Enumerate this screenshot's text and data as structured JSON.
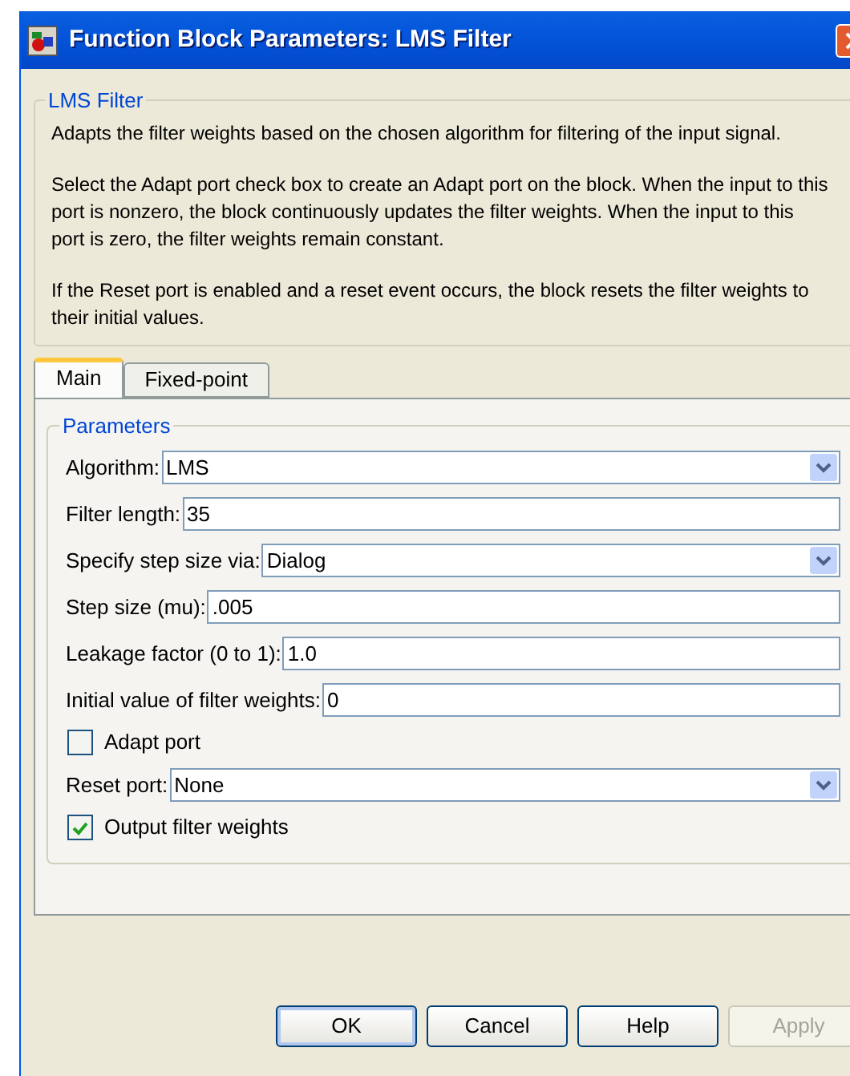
{
  "window": {
    "title": "Function Block Parameters: LMS Filter"
  },
  "description": {
    "title": "LMS Filter",
    "paragraphs": [
      "Adapts the filter weights based on the chosen algorithm for filtering of the input signal.",
      "Select the Adapt port check box to create an Adapt port on the block. When the input to this port is nonzero, the block continuously updates the filter weights. When the input to this port is zero, the filter weights remain constant.",
      "If the Reset port is enabled and a reset event occurs, the block resets the filter weights to their initial values."
    ]
  },
  "tabs": [
    {
      "label": "Main",
      "selected": true
    },
    {
      "label": "Fixed-point",
      "selected": false
    }
  ],
  "parameters": {
    "title": "Parameters",
    "items": [
      {
        "kind": "select",
        "label": "Algorithm:",
        "value": "LMS"
      },
      {
        "kind": "text",
        "label": "Filter length:",
        "value": "35"
      },
      {
        "kind": "select",
        "label": "Specify step size via:",
        "value": "Dialog"
      },
      {
        "kind": "text",
        "label": "Step size (mu):",
        "value": ".005"
      },
      {
        "kind": "text",
        "label": "Leakage factor (0 to 1):",
        "value": "1.0"
      },
      {
        "kind": "text",
        "label": "Initial value of filter weights:",
        "value": "0"
      },
      {
        "kind": "checkbox",
        "label": "Adapt port",
        "checked": false
      },
      {
        "kind": "select",
        "label": "Reset port:",
        "value": "None"
      },
      {
        "kind": "checkbox",
        "label": "Output filter weights",
        "checked": true
      }
    ]
  },
  "buttons": [
    {
      "label": "OK",
      "disabled": false,
      "default": true
    },
    {
      "label": "Cancel",
      "disabled": false,
      "default": false
    },
    {
      "label": "Help",
      "disabled": false,
      "default": false
    },
    {
      "label": "Apply",
      "disabled": true,
      "default": false
    }
  ]
}
